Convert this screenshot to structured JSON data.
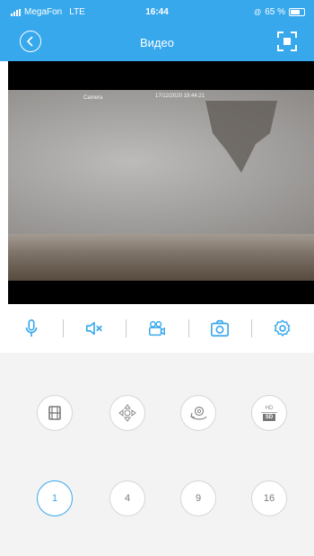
{
  "status_bar": {
    "carrier": "MegaFon",
    "network": "LTE",
    "time": "16:44",
    "battery": "65 %"
  },
  "header": {
    "title": "Видео"
  },
  "video": {
    "osd_camera": "Camera",
    "osd_timestamp": "17/12/2020 19:44:21"
  },
  "toolbar": {
    "icons": [
      "microphone-icon",
      "mute-icon",
      "record-icon",
      "snapshot-icon",
      "settings-icon"
    ]
  },
  "controls": {
    "row1": [
      "playback-icon",
      "ptz-icon",
      "preset-icon",
      "quality-toggle"
    ],
    "quality": {
      "hd": "HD",
      "sd": "SD"
    },
    "layouts": [
      "1",
      "4",
      "9",
      "16"
    ],
    "active_layout": "1"
  },
  "colors": {
    "accent": "#37a8ec",
    "panel_bg": "#f3f3f3"
  }
}
